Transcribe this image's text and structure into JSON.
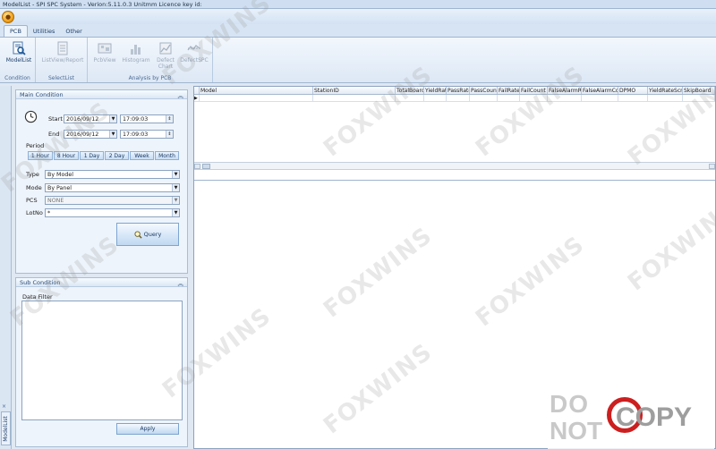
{
  "window": {
    "title": "ModelList - SPI SPC System - Verion:5.11.0.3 Unitmm Licence key id:"
  },
  "tabs": [
    {
      "label": "PCB",
      "active": true
    },
    {
      "label": "Utilities",
      "active": false
    },
    {
      "label": "Other",
      "active": false
    }
  ],
  "ribbon": {
    "groups": [
      {
        "name": "Condition",
        "buttons": [
          {
            "label": "ModelList",
            "icon": "search-list-icon",
            "enabled": true
          }
        ]
      },
      {
        "name": "SelectList",
        "buttons": [
          {
            "label": "ListView/Report",
            "icon": "report-icon",
            "enabled": false
          }
        ]
      },
      {
        "name": "Analysis by PCB",
        "buttons": [
          {
            "label": "PcbView",
            "icon": "pcb-view-icon",
            "enabled": false
          },
          {
            "label": "Histogram",
            "icon": "histogram-icon",
            "enabled": false
          },
          {
            "label": "Defect Chart",
            "icon": "defect-chart-icon",
            "enabled": false
          },
          {
            "label": "DefectSPC",
            "icon": "defect-spc-icon",
            "enabled": false
          }
        ]
      }
    ]
  },
  "main_condition": {
    "title": "Main Condition",
    "start_label": "Start",
    "start_date": "2016/09/12",
    "start_time": "17:09:03",
    "end_label": "End",
    "end_date": "2016/09/12",
    "end_time": "17:09:03",
    "period_label": "Period",
    "period_buttons": [
      "1 Hour",
      "8 Hour",
      "1 Day",
      "2 Day",
      "Week",
      "Month"
    ],
    "type_label": "Type",
    "type_value": "By Model",
    "mode_label": "Mode",
    "mode_value": "By Panel",
    "pcs_label": "PCS",
    "pcs_value": "NONE",
    "lotno_label": "LotNo",
    "lotno_value": "*",
    "query_label": "Query"
  },
  "sub_condition": {
    "title": "Sub Condition",
    "filter_label": "Data Filter",
    "apply_label": "Apply"
  },
  "sidebar": {
    "vertical_tab": "ModelList",
    "pin_label": "×"
  },
  "grid": {
    "columns": [
      "Model",
      "StationID",
      "TotalBoard",
      "YieldRate",
      "PassRate",
      "PassCount",
      "FailRate",
      "FailCount",
      "FalseAlarmRate",
      "FalseAlarmCount",
      "DPMO",
      "YieldRateScrap",
      "SkipBoard"
    ]
  },
  "watermark": {
    "text": "FOXWINS"
  },
  "stamp": {
    "line1": "DO",
    "line2": "NOT",
    "copy": "COPY"
  }
}
